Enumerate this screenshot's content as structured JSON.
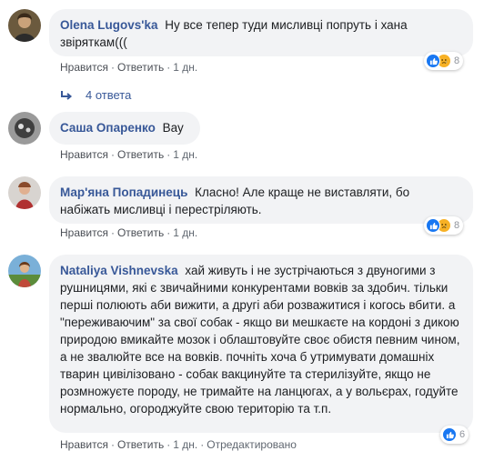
{
  "comments": [
    {
      "author": "Olena Lugovs'ka",
      "text": "Ну все тепер туди мисливці попруть і хана звіряткам(((",
      "like_label": "Нравится",
      "reply_label": "Ответить",
      "time": "1 дн.",
      "reaction_count": "8",
      "reactions": [
        "like-icon",
        "sad-icon"
      ]
    },
    {
      "author": "Саша Опаренко",
      "text": "Вау",
      "like_label": "Нравится",
      "reply_label": "Ответить",
      "time": "1 дн."
    },
    {
      "author": "Мар'яна Попадинець",
      "text": "Класно! Але краще не виставляти, бо набіжать мисливці і перестріляють.",
      "like_label": "Нравится",
      "reply_label": "Ответить",
      "time": "1 дн.",
      "reaction_count": "8",
      "reactions": [
        "like-icon",
        "sad-icon"
      ]
    },
    {
      "author": "Nataliya Vishnevska",
      "text": "хай живуть і не зустрічаються з двуногими з рушницями, які є звичайними конкурентами вовків за здобич. тільки перші полюють аби вижити, а другі аби розважитися і когось вбити. а \"переживаючим\" за свої собак - якщо ви мешкаєте на кордоні з дикою природою вмикайте мозок і облаштовуйте своє обистя певним чином, а не звалюйте все на вовків. почніть хоча б утримувати домашніх тварин цивілізовано - собак вакцинуйте та стерилізуйте, якщо не розмножуєте породу, не тримайте на ланцюгах, а у вольєрах, годуйте нормально, огороджуйте свою територію та т.п.",
      "like_label": "Нравится",
      "reply_label": "Ответить",
      "time": "1 дн.",
      "edited_label": "Отредактировано",
      "reaction_count": "6",
      "reactions": [
        "like-icon"
      ]
    }
  ],
  "replies_link": "4 ответа",
  "colors": {
    "author": "#385898",
    "bubble": "#f2f3f5",
    "meta": "#606770",
    "like": "#1877f2",
    "sad": "#f7b125"
  }
}
